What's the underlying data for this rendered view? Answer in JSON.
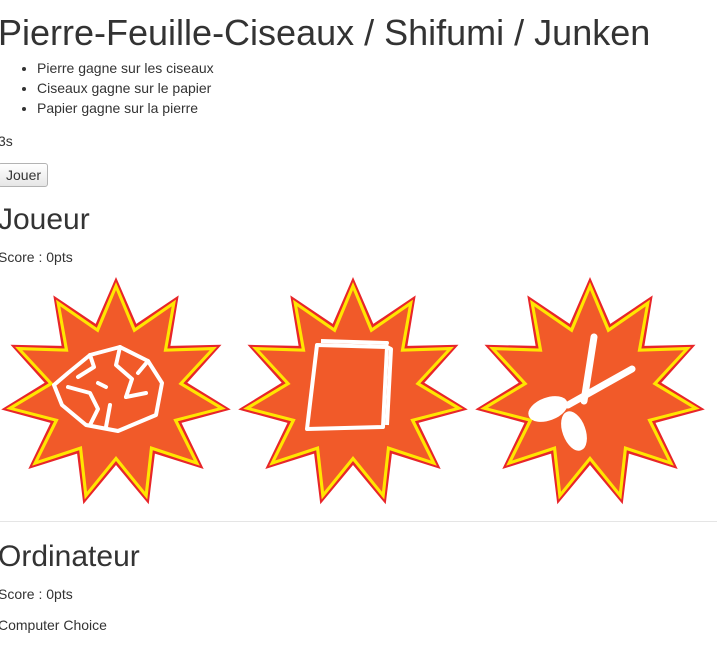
{
  "title": "Pierre-Feuille-Ciseaux / Shifumi / Junken",
  "rules": [
    "Pierre gagne sur les ciseaux",
    "Ciseaux gagne sur le papier",
    "Papier gagne sur la pierre"
  ],
  "timer": "3s",
  "play_button_label": "Jouer",
  "player": {
    "heading": "Joueur",
    "score": "Score : 0pts",
    "choices": [
      {
        "name": "pierre",
        "icon": "rock-icon"
      },
      {
        "name": "papier",
        "icon": "paper-icon"
      },
      {
        "name": "ciseaux",
        "icon": "scissors-icon"
      }
    ]
  },
  "computer": {
    "heading": "Ordinateur",
    "score": "Score : 0pts",
    "choice_label": "Computer Choice"
  },
  "colors": {
    "burst_outer": "#e8262a",
    "burst_ring": "#ffe600",
    "burst_fill": "#f15a29",
    "icon_stroke": "#ffffff"
  }
}
